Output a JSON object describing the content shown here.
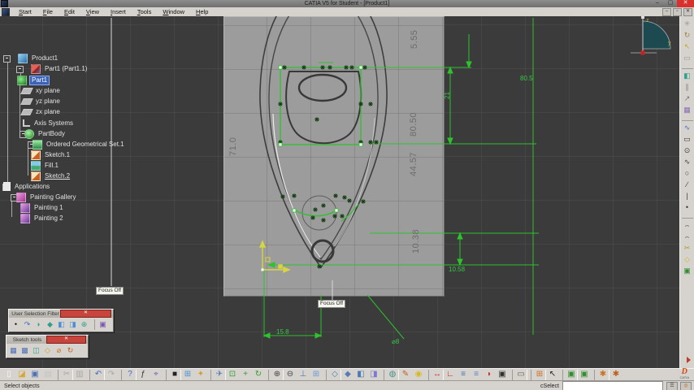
{
  "window": {
    "title": "CATIA V5 for Student - [Product1]"
  },
  "menu": {
    "items": [
      "Start",
      "File",
      "Edit",
      "View",
      "Insert",
      "Tools",
      "Window",
      "Help"
    ]
  },
  "tree": {
    "items": [
      {
        "label": "Product1"
      },
      {
        "label": "Part1 (Part1.1)"
      },
      {
        "label": "Part1",
        "selected": true
      },
      {
        "label": "xy plane"
      },
      {
        "label": "yz plane"
      },
      {
        "label": "zx plane"
      },
      {
        "label": "Axis Systems"
      },
      {
        "label": "PartBody"
      },
      {
        "label": "Ordered Geometrical Set.1"
      },
      {
        "label": "Sketch.1"
      },
      {
        "label": "Fill.1"
      },
      {
        "label": "Sketch.2",
        "underlined": true
      },
      {
        "label": "Applications"
      },
      {
        "label": "Painting Gallery"
      },
      {
        "label": "Painting 1"
      },
      {
        "label": "Painting 2"
      }
    ]
  },
  "canvas": {
    "dims": {
      "d5_55": "5.55",
      "d71_0": "71.0",
      "d80_50": "80.50",
      "d44_57": "44.57",
      "d10_38": "10.38",
      "d80_5": "80.5",
      "d21": "21",
      "d10_58": "10.58",
      "d15_8": "15.8",
      "dia8": "⌀8"
    },
    "focus_label": "Focus Off",
    "compass": {
      "z": "z",
      "y": "y"
    }
  },
  "toolbars": {
    "user_selection_filter": {
      "title": "User Selection Filter",
      "buttons": [
        {
          "name": "point-filter-icon",
          "glyph": "•",
          "color": "#222222"
        },
        {
          "name": "curve-filter-icon",
          "glyph": "↷",
          "color": "#3f6cc4"
        },
        {
          "name": "surface-filter-icon",
          "glyph": "◗",
          "color": "#2f9f8f"
        },
        {
          "name": "volume-filter-icon",
          "glyph": "◆",
          "color": "#2f9f8f"
        },
        {
          "name": "feature-filter-icon",
          "glyph": "◧",
          "color": "#4a8fd4"
        },
        {
          "name": "geometrical-feature-filter-icon",
          "glyph": "◨",
          "color": "#4a8fd4"
        },
        {
          "name": "intersection-filter-icon",
          "glyph": "⊕",
          "color": "#2f9f8f"
        },
        {
          "name": "selection-modes-icon",
          "glyph": "▣",
          "color": "#7a5ab0",
          "sep": "1"
        }
      ]
    },
    "sketch_tools": {
      "title": "Sketch tools",
      "buttons": [
        {
          "name": "grid-toggle-icon",
          "glyph": "▦",
          "color": "#4a6fb5"
        },
        {
          "name": "snap-to-point-icon",
          "glyph": "▩",
          "color": "#4a6fb5"
        },
        {
          "name": "construction-element-icon",
          "glyph": "◫",
          "color": "#2f9f8f"
        },
        {
          "name": "geometrical-constraints-icon",
          "glyph": "◇",
          "color": "#c8a820"
        },
        {
          "name": "dimensional-constraints-icon",
          "glyph": "⌀",
          "color": "#d07020"
        },
        {
          "name": "auto-constraint-icon",
          "glyph": "↻",
          "color": "#c06020"
        }
      ]
    },
    "bottom": {
      "buttons": [
        {
          "name": "new-document-icon",
          "glyph": "▯",
          "color": "#fafafa"
        },
        {
          "name": "open-folder-icon",
          "glyph": "◪",
          "color": "#d9a62e"
        },
        {
          "name": "save-icon",
          "glyph": "▣",
          "color": "#4a6fb5"
        },
        {
          "name": "print-icon",
          "glyph": "▤",
          "color": "#c4c4c4"
        },
        {
          "name": "cut-icon",
          "glyph": "✂",
          "color": "#a8a8a8",
          "sep": "1"
        },
        {
          "name": "copy-icon",
          "glyph": "▥",
          "color": "#a8a8a8"
        },
        {
          "name": "undo-icon",
          "glyph": "↶",
          "color": "#3f6cc4",
          "sep": "1"
        },
        {
          "name": "redo-icon",
          "glyph": "↷",
          "color": "#a8a8a8"
        },
        {
          "name": "whats-this-icon",
          "glyph": "?",
          "color": "#3f6cc4",
          "sep": "1"
        },
        {
          "name": "formula-fx-icon",
          "glyph": "ƒ",
          "color": "#333333"
        },
        {
          "name": "search-telescope-icon",
          "glyph": "⌖",
          "color": "#7a5ab0"
        },
        {
          "name": "knowledge-palette-icon",
          "glyph": "■",
          "color": "#222222",
          "sep": "1"
        },
        {
          "name": "structure-tree-icon",
          "glyph": "⊞",
          "color": "#4a8fd4"
        },
        {
          "name": "manipulation-hand-icon",
          "glyph": "✦",
          "color": "#d0a030"
        },
        {
          "name": "fly-mode-icon",
          "glyph": "✈",
          "color": "#4a7ab5",
          "sep": "1"
        },
        {
          "name": "fit-all-in-icon",
          "glyph": "⊡",
          "color": "#2f9f2f"
        },
        {
          "name": "pan-icon",
          "glyph": "+",
          "color": "#2f9f2f"
        },
        {
          "name": "rotate-icon",
          "glyph": "↻",
          "color": "#2f9f2f"
        },
        {
          "name": "zoom-in-icon",
          "glyph": "⊕",
          "color": "#444444",
          "sep": "1"
        },
        {
          "name": "zoom-out-icon",
          "glyph": "⊖",
          "color": "#444444"
        },
        {
          "name": "normal-view-icon",
          "glyph": "⊥",
          "color": "#4a7ab5"
        },
        {
          "name": "multi-view-icon",
          "glyph": "⊞",
          "color": "#6a9ad4"
        },
        {
          "name": "iso-view-icon",
          "glyph": "◇",
          "color": "#4a7ab5",
          "sep": "1"
        },
        {
          "name": "shaded-view-icon",
          "glyph": "◆",
          "color": "#5a7ab5"
        },
        {
          "name": "hide-show-icon",
          "glyph": "◧",
          "color": "#4a7ab5"
        },
        {
          "name": "swap-visible-space-icon",
          "glyph": "◨",
          "color": "#7a7ad0"
        },
        {
          "name": "apply-material-icon",
          "glyph": "◍",
          "color": "#4a8f8f",
          "sep": "1"
        },
        {
          "name": "paint-icon",
          "glyph": "✎",
          "color": "#c06020"
        },
        {
          "name": "light-icon",
          "glyph": "◉",
          "color": "#d8b820"
        },
        {
          "name": "measure-between-icon",
          "glyph": "↔",
          "color": "#cc2020",
          "sep": "1"
        },
        {
          "name": "measure-item-icon",
          "glyph": "∟",
          "color": "#cc2020"
        },
        {
          "name": "annotation-list-icon",
          "glyph": "≡",
          "color": "#4a6fb5"
        },
        {
          "name": "annotation-list-2-icon",
          "glyph": "≡",
          "color": "#5a7fc5"
        },
        {
          "name": "catalog-icon",
          "glyph": "◗",
          "color": "#cc3030"
        },
        {
          "name": "capture-icon",
          "glyph": "▣",
          "color": "#303030"
        },
        {
          "name": "ruler-icon",
          "glyph": "▭",
          "color": "#606060",
          "sep": "1"
        },
        {
          "name": "grid-icon",
          "glyph": "⊞",
          "color": "#d07020",
          "sep": "1"
        },
        {
          "name": "recenter-arrow-icon",
          "glyph": "↖",
          "color": "#222222"
        },
        {
          "name": "vb-script-icon",
          "glyph": "▣",
          "color": "#2f8f2f",
          "sep": "1"
        },
        {
          "name": "vb-script-2-icon",
          "glyph": "▣",
          "color": "#2f8f2f"
        },
        {
          "name": "tool-orange-icon",
          "glyph": "✱",
          "color": "#d07020",
          "sep": "1"
        },
        {
          "name": "tool-orange-2-icon",
          "glyph": "✱",
          "color": "#c06020"
        }
      ]
    },
    "right": {
      "buttons": [
        {
          "name": "sketch-tools-star-icon",
          "glyph": "✳",
          "color": "#9a9a9a"
        },
        {
          "name": "update-workbench-icon",
          "glyph": "↻",
          "color": "#a0824a"
        },
        {
          "name": "select-pointer-icon",
          "glyph": "↖",
          "color": "#c8a820"
        },
        {
          "name": "disabled-tool-icon",
          "glyph": "▭",
          "color": "#9a9a9a"
        },
        {
          "name": "isolate-cube-icon",
          "glyph": "◧",
          "color": "#2f9f8f",
          "sep": "1"
        },
        {
          "name": "attach-clip-icon",
          "glyph": "∥",
          "color": "#888888"
        },
        {
          "name": "diagonal-arrow-icon",
          "glyph": "↗",
          "color": "#777777"
        },
        {
          "name": "image-frame-icon",
          "glyph": "▦",
          "color": "#8a6fb0"
        },
        {
          "name": "profile-spline-icon",
          "glyph": "∿",
          "color": "#3f6cc4",
          "sep": "1"
        },
        {
          "name": "rectangle-tool-icon",
          "glyph": "▭",
          "color": "#3a3a3a"
        },
        {
          "name": "circle-tool-icon",
          "glyph": "⊙",
          "color": "#3a3a3a"
        },
        {
          "name": "spline-tool-icon",
          "glyph": "∿",
          "color": "#3a3a3a"
        },
        {
          "name": "ellipse-tool-icon",
          "glyph": "○",
          "color": "#3a3a3a"
        },
        {
          "name": "line-tool-icon",
          "glyph": "∕",
          "color": "#3a3a3a"
        },
        {
          "name": "axis-tool-icon",
          "glyph": "|",
          "color": "#3a3a3a"
        },
        {
          "name": "point-tool-icon",
          "glyph": "•",
          "color": "#3a3a3a"
        },
        {
          "name": "arc-tool-icon",
          "glyph": "⌢",
          "color": "#3a3a3a",
          "sep": "1"
        },
        {
          "name": "three-point-arc-icon",
          "glyph": "⌢",
          "color": "#3a3a3a"
        },
        {
          "name": "trim-tool-icon",
          "glyph": "✂",
          "color": "#b0a020"
        },
        {
          "name": "constraint-tool-icon",
          "glyph": "◇",
          "color": "#c8b820"
        },
        {
          "name": "constraint-box-icon",
          "glyph": "▣",
          "color": "#2f8f2f"
        }
      ]
    }
  },
  "status": {
    "left": "Select objects",
    "command_label": "cSelect",
    "command_value": ""
  },
  "logo": {
    "text": "D",
    "sub": "CATIA"
  },
  "colors": {
    "accent_green": "#2ec22e",
    "selection_blue": "#3a63b8",
    "canvas_gray": "#9c9c9c",
    "close_red": "#d9302c",
    "axis_yellow": "#d6d642"
  }
}
